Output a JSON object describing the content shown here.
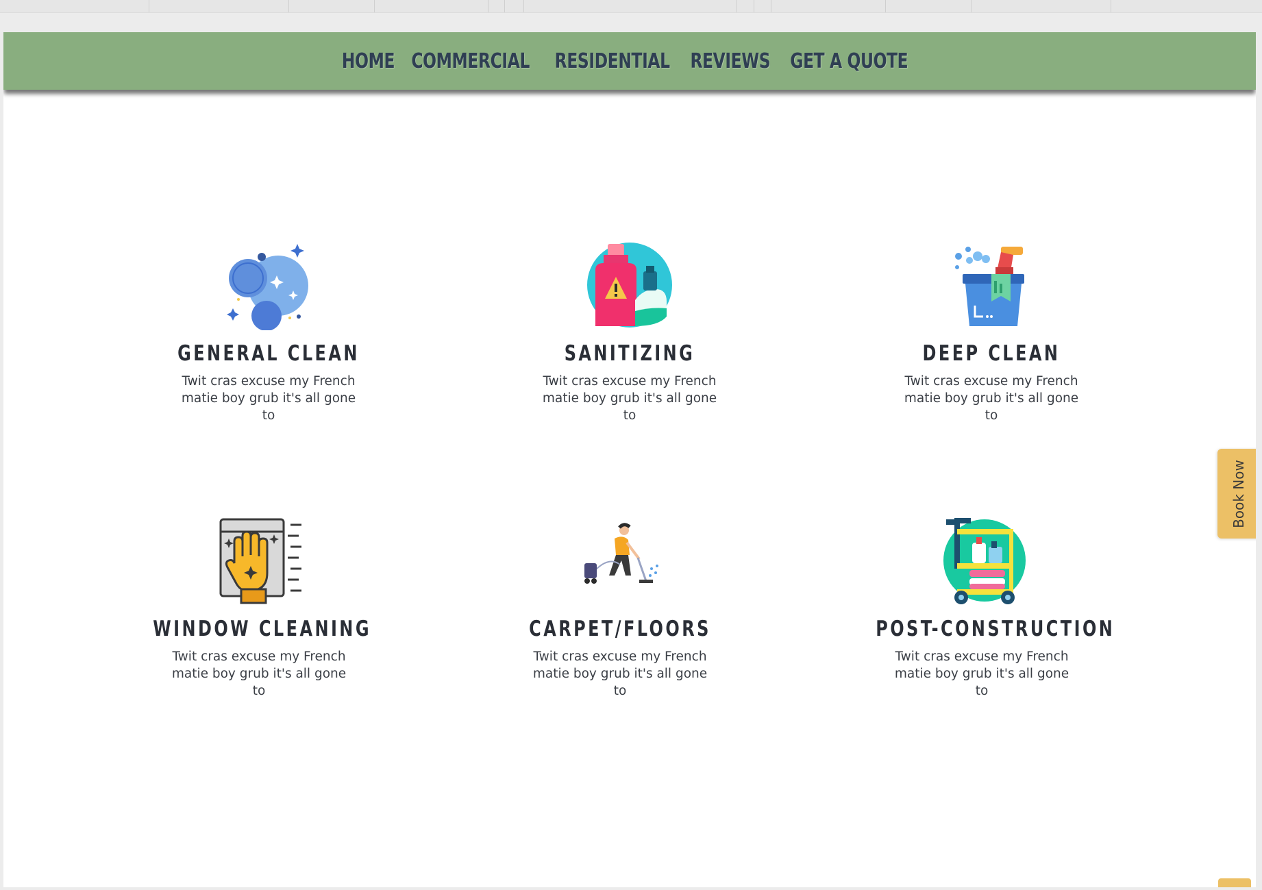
{
  "nav": {
    "items": [
      "HOME",
      "COMMERCIAL",
      "RESIDENTIAL",
      "REVIEWS",
      "GET A QUOTE"
    ]
  },
  "services": [
    {
      "title": "GENERAL CLEAN",
      "desc": "Twit cras excuse my French matie boy grub it's all gone to",
      "icon": "bubbles-icon"
    },
    {
      "title": "SANITIZING",
      "desc": "Twit cras excuse my French matie boy grub it's all gone to",
      "icon": "disinfectant-bottles-icon"
    },
    {
      "title": "DEEP CLEAN",
      "desc": "Twit cras excuse my French matie boy grub it's all gone to",
      "icon": "cleaning-bucket-icon"
    },
    {
      "title": "WINDOW CLEANING",
      "desc": "Twit cras excuse my French matie boy grub it's all gone to",
      "icon": "glove-window-icon"
    },
    {
      "title": "CARPET/FLOORS",
      "desc": "Twit cras excuse my French matie boy grub it's all gone to",
      "icon": "vacuum-cleaner-person-icon"
    },
    {
      "title": "POST-CONSTRUCTION",
      "desc": "Twit cras excuse my French matie boy grub it's all gone to",
      "icon": "cleaning-cart-icon"
    }
  ],
  "book_now": {
    "label": "Book Now"
  },
  "scroll_top": {
    "icon": "chevron-up-icon"
  },
  "colors": {
    "nav_bg": "#89ae7f",
    "nav_text": "#2f3f53",
    "accent": "#ecc066",
    "heading": "#2a2e36"
  }
}
